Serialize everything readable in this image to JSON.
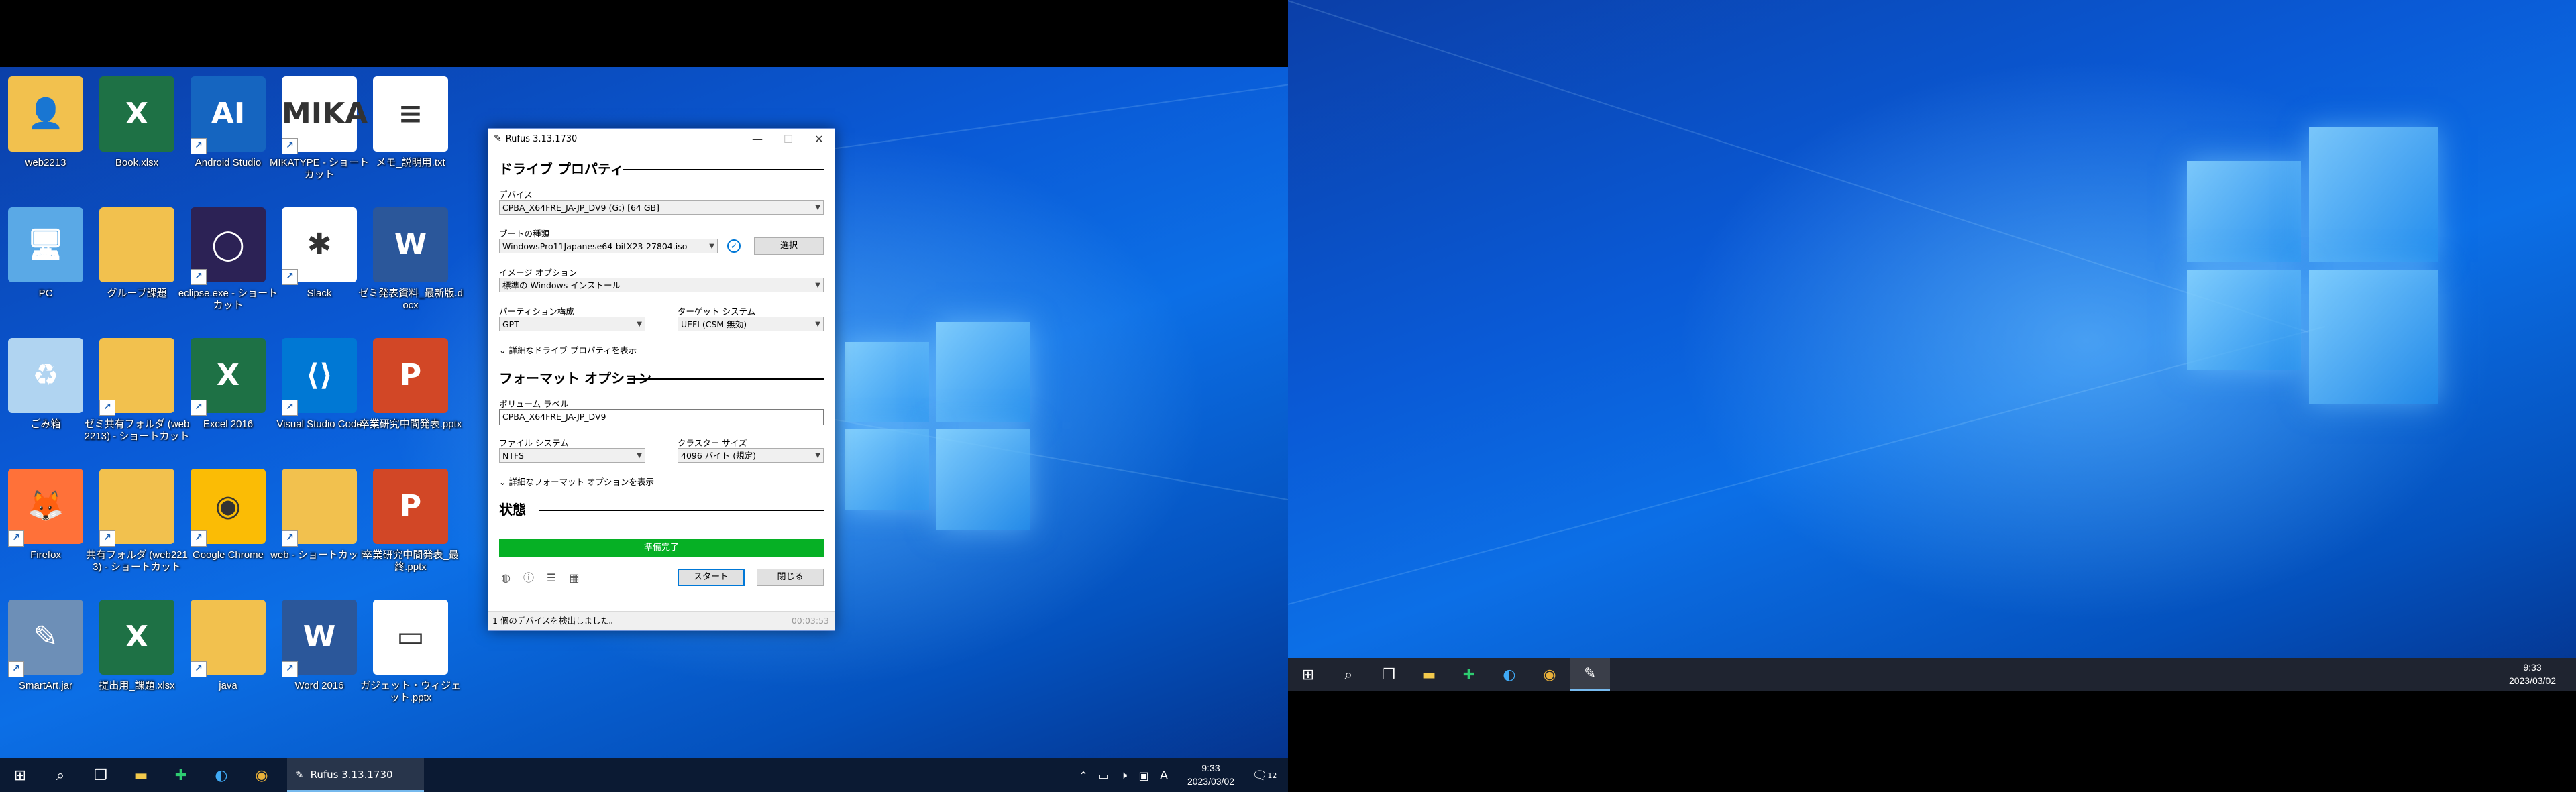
{
  "monitor1": {
    "desktop_icons": [
      {
        "label": "web2213"
      },
      {
        "label": "Book.xlsx"
      },
      {
        "label": "Android Studio"
      },
      {
        "label": "MIKATYPE - ショートカット"
      },
      {
        "label": "メモ_説明用.txt"
      },
      {
        "label": "PC"
      },
      {
        "label": "グループ課題"
      },
      {
        "label": "eclipse.exe - ショートカット"
      },
      {
        "label": "Slack"
      },
      {
        "label": "ゼミ発表資料_最新版.docx"
      },
      {
        "label": "ごみ箱"
      },
      {
        "label": "ゼミ共有フォルダ (web2213) - ショートカット"
      },
      {
        "label": "Excel 2016"
      },
      {
        "label": "Visual Studio Code"
      },
      {
        "label": "卒業研究中間発表.pptx"
      },
      {
        "label": "Firefox"
      },
      {
        "label": "共有フォルダ (web2213) - ショートカット"
      },
      {
        "label": "Google Chrome"
      },
      {
        "label": "web - ショートカット"
      },
      {
        "label": "卒業研究中間発表_最終.pptx"
      },
      {
        "label": "SmartArt.jar"
      },
      {
        "label": "提出用_課題.xlsx"
      },
      {
        "label": "java"
      },
      {
        "label": "Word 2016"
      },
      {
        "label": "ガジェット・ウィジェット.pptx"
      }
    ],
    "taskbar": {
      "active_app_label": "Rufus 3.13.1730",
      "ime_label": "A",
      "clock_time": "9:33",
      "clock_date": "2023/03/02",
      "notification_count": "12"
    }
  },
  "rufus": {
    "title": "Rufus 3.13.1730",
    "section_drive": "ドライブ プロパティ",
    "device_label": "デバイス",
    "device_value": "CPBA_X64FRE_JA-JP_DV9 (G:) [64 GB]",
    "boot_type_label": "ブートの種類",
    "boot_type_value": "WindowsPro11Japanese64-bitX23-27804.iso",
    "select_button": "選択",
    "image_option_label": "イメージ オプション",
    "image_option_value": "標準の Windows インストール",
    "partition_label": "パーティション構成",
    "partition_value": "GPT",
    "target_label": "ターゲット システム",
    "target_value": "UEFI (CSM 無効)",
    "advanced_drive_toggle": "詳細なドライブ プロパティを表示",
    "section_format": "フォーマット オプション",
    "volume_label": "ボリューム ラベル",
    "volume_value": "CPBA_X64FRE_JA-JP_DV9",
    "fs_label": "ファイル システム",
    "fs_value": "NTFS",
    "cluster_label": "クラスター サイズ",
    "cluster_value": "4096 バイト (規定)",
    "advanced_format_toggle": "詳細なフォーマット オプションを表示",
    "section_status": "状態",
    "progress_text": "準備完了",
    "progress_fraction": 1.0,
    "start_button": "スタート",
    "close_button": "閉じる",
    "status_text": "1 個のデバイスを検出しました。",
    "elapsed": "00:03:53"
  },
  "monitor2": {
    "taskbar": {
      "clock_time": "9:33",
      "clock_date": "2023/03/02"
    }
  },
  "colors": {
    "taskbar": "#0b1a33",
    "progress": "#06b025",
    "accent": "#0078d7"
  }
}
